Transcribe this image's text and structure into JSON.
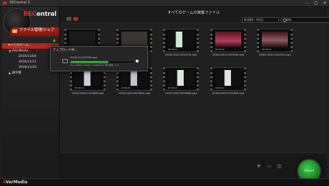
{
  "window": {
    "title": "RECentral 3",
    "controls": [
      "–",
      "▢",
      "✕"
    ]
  },
  "logo": {
    "prefix": "REC",
    "suffix": "entral"
  },
  "sidebar": {
    "active_tab": "ファイル管理/シェア",
    "items": [
      {
        "label": "すべてのゲーム",
        "level": 0,
        "selected": true
      },
      {
        "label": "AVerMedia",
        "level": 1,
        "expanded": true
      },
      {
        "label": "2016/11/04",
        "level": 2
      },
      {
        "label": "2016/11/11",
        "level": 2
      },
      {
        "label": "2016/11/19",
        "level": 2
      },
      {
        "label": "論今曜",
        "level": 1,
        "expanded": false
      }
    ]
  },
  "main": {
    "title": "すべてのゲームの映像ファイル",
    "sort_placeholder": "表示順序・作成日",
    "search_placeholder": "検索"
  },
  "thumbnails": [
    {
      "duration": "00:00:14",
      "filename": ""
    },
    {
      "duration": "00:00:43",
      "filename": ""
    },
    {
      "duration": "00:00:21",
      "filename": "20161104213210976.mp4"
    },
    {
      "duration": "00:00:12",
      "filename": "20161104211955548.mp4"
    },
    {
      "duration": "00:00:22",
      "filename": "20161104211944203.mp4"
    },
    {
      "duration": "00:00:11",
      "filename": "20161104211125808.mp4"
    },
    {
      "duration": "00:00:14",
      "filename": "20161104211003842.mp4"
    },
    {
      "duration": "00:00:12",
      "filename": "20161104210939648.mp4"
    },
    {
      "duration": "00:00:17",
      "filename": "20161104210131828.mp4"
    }
  ],
  "upload_dialog": {
    "title": "アップロード中...",
    "file": "20161111133339.mp4",
    "progress": 0.6,
    "status": "18.1 23980 1.56GB / 1.6GB(95%) 残り時間 : 0:0:"
  },
  "record_label": "Record",
  "colors": {
    "accent": "#c0281f",
    "record": "#2faa3b"
  },
  "taskbar": {
    "brand_prefix": "A",
    "brand_rest": "VerMedia"
  }
}
